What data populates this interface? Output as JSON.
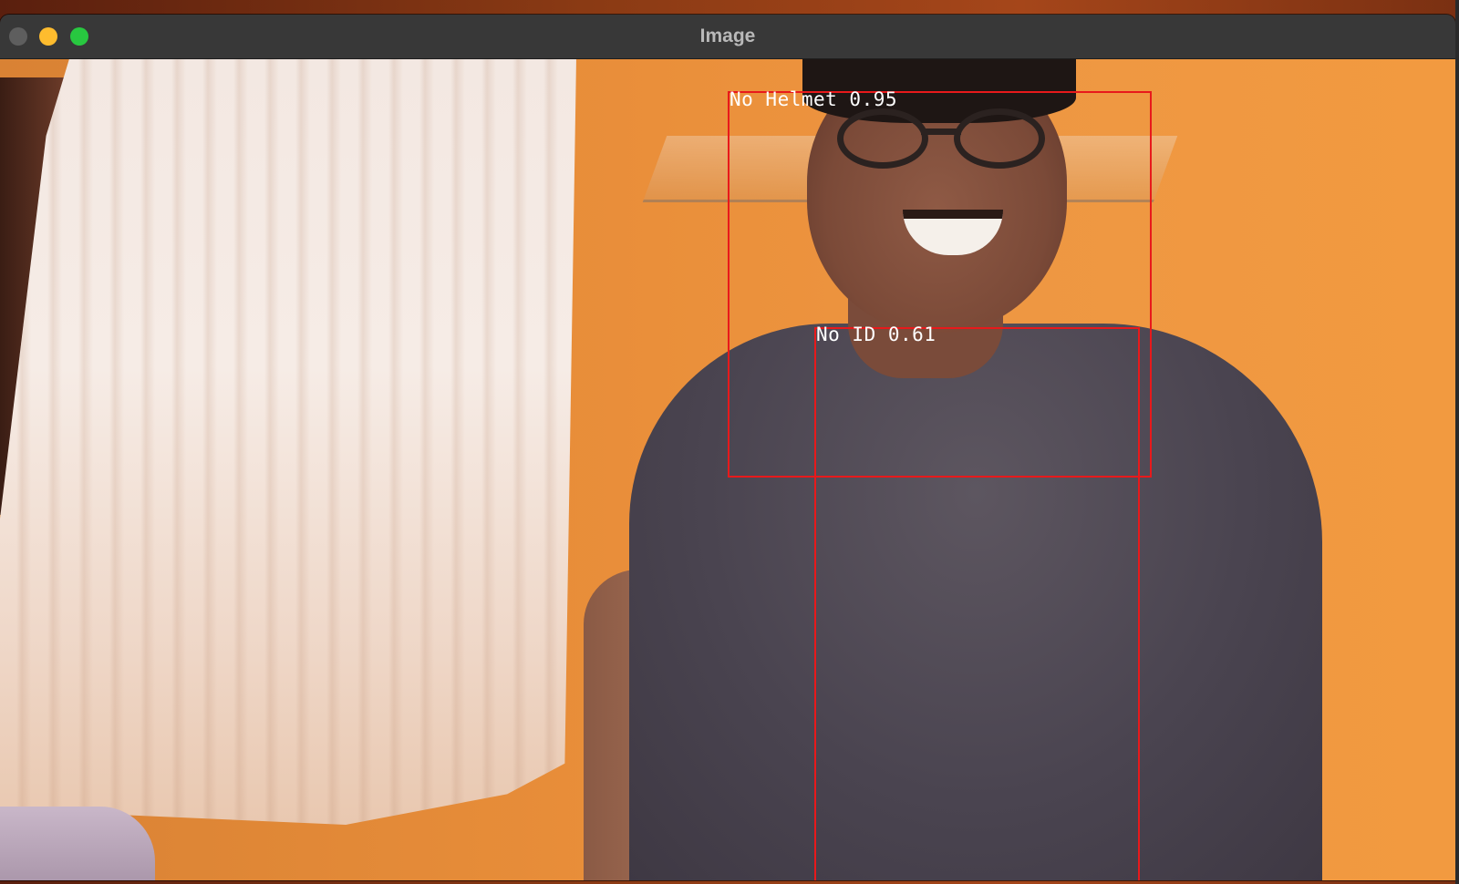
{
  "window": {
    "title": "Image"
  },
  "detections": [
    {
      "label": "No Helmet 0.95",
      "class_name": "No Helmet",
      "confidence": 0.95,
      "box_color": "#e8191b"
    },
    {
      "label": "No ID 0.61",
      "class_name": "No ID",
      "confidence": 0.61,
      "box_color": "#e8191b"
    }
  ],
  "colors": {
    "titlebar": "#383838",
    "title_text": "#b9b9b9",
    "close_button": "#5e5e5e",
    "minimize_button": "#febc2e",
    "maximize_button": "#28c840",
    "box": "#e8191b",
    "label_text": "#ffffff"
  }
}
